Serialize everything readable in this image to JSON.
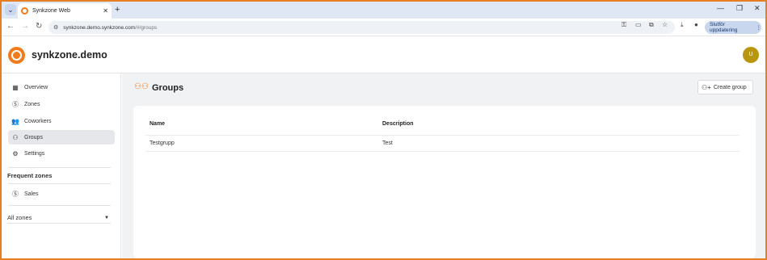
{
  "browser": {
    "tab_title": "Synkzone Web",
    "tab_close": "✕",
    "new_tab": "+",
    "url_host": "synkzone.demo.synkzone.com",
    "url_path": "/#/groups",
    "update_label": "Slutför uppdatering"
  },
  "app": {
    "site_name": "synkzone.demo",
    "avatar_initial": "U"
  },
  "sidebar": {
    "items": [
      {
        "label": "Overview",
        "icon": "grid-icon"
      },
      {
        "label": "Zones",
        "icon": "zone-icon"
      },
      {
        "label": "Coworkers",
        "icon": "people-icon"
      },
      {
        "label": "Groups",
        "icon": "groups-icon",
        "active": true
      },
      {
        "label": "Settings",
        "icon": "gear-icon"
      }
    ],
    "frequent_heading": "Frequent zones",
    "frequent_items": [
      {
        "label": "Sales",
        "icon": "zone-icon"
      }
    ],
    "all_zones_label": "All zones"
  },
  "main": {
    "title": "Groups",
    "create_button": "Create group",
    "table": {
      "columns": [
        "Name",
        "Description"
      ],
      "rows": [
        {
          "name": "Testgrupp",
          "description": "Test"
        }
      ]
    }
  },
  "colors": {
    "accent": "#f07b1d",
    "frame": "#e67e22",
    "avatar": "#b8960f"
  }
}
